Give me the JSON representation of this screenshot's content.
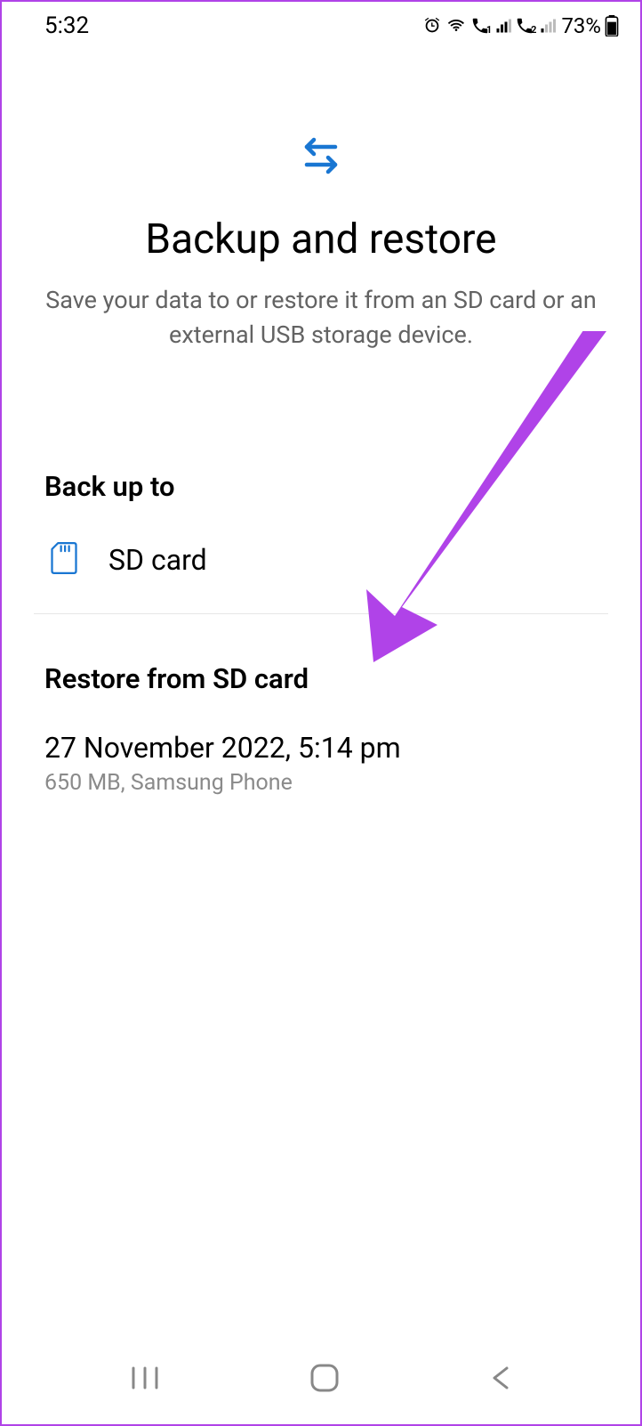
{
  "status_bar": {
    "time": "5:32",
    "battery_percent": "73%"
  },
  "header": {
    "title": "Backup and restore",
    "subtitle": "Save your data to or restore it from an SD card or an external USB storage device."
  },
  "backup": {
    "section_title": "Back up to",
    "option_label": "SD card"
  },
  "restore": {
    "section_title": "Restore from SD card",
    "item_title": "27 November 2022, 5:14 pm",
    "item_subtitle": "650 MB, Samsung Phone"
  }
}
